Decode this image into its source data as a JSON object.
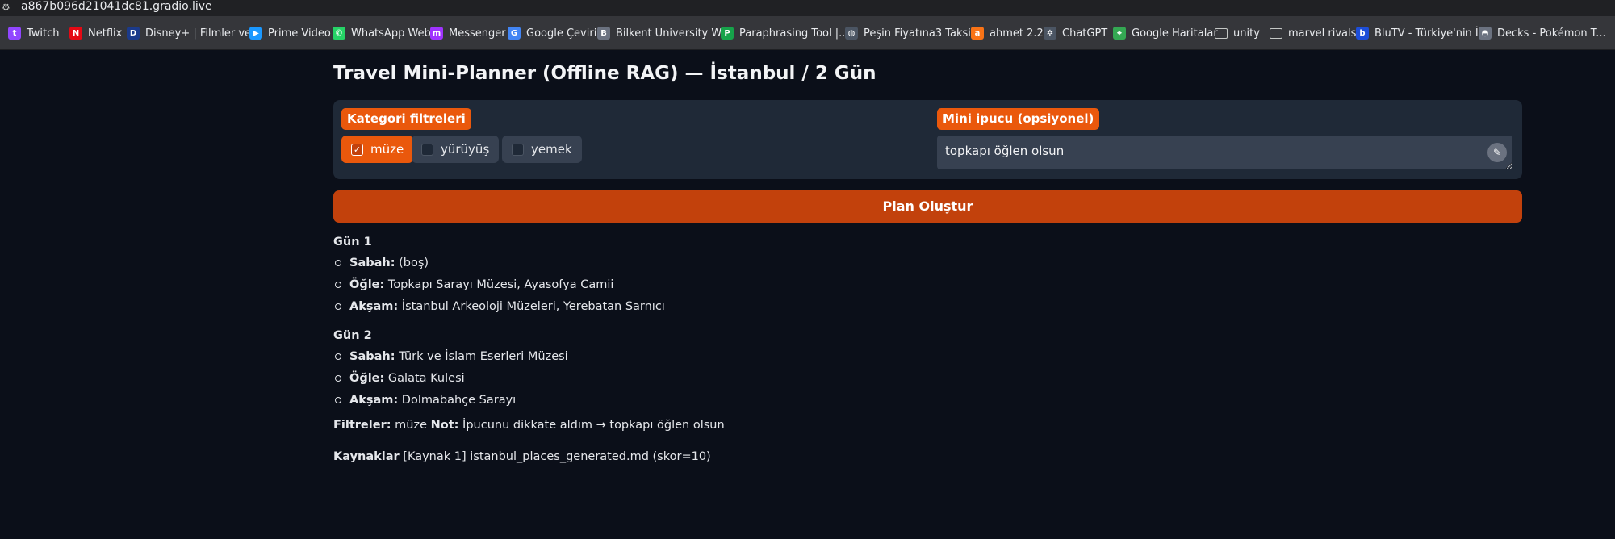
{
  "browser": {
    "url": "a867b096d21041dc81.gradio.live",
    "bookmarks": [
      {
        "label": "Twitch",
        "icon": "twitch-icon",
        "color": "#9146ff",
        "glyph": "t"
      },
      {
        "label": "Netflix",
        "icon": "netflix-icon",
        "color": "#e50914",
        "glyph": "N"
      },
      {
        "label": "Disney+ | Filmler ve...",
        "icon": "disney-icon",
        "color": "#1b3a8a",
        "glyph": "D"
      },
      {
        "label": "Prime Video",
        "icon": "prime-video-icon",
        "color": "#1a98ff",
        "glyph": "▶"
      },
      {
        "label": "WhatsApp Web",
        "icon": "whatsapp-icon",
        "color": "#25d366",
        "glyph": "✆"
      },
      {
        "label": "Messenger",
        "icon": "messenger-icon",
        "color": "#a033ff",
        "glyph": "m"
      },
      {
        "label": "Google Çeviri",
        "icon": "google-translate-icon",
        "color": "#4285f4",
        "glyph": "G"
      },
      {
        "label": "Bilkent University W...",
        "icon": "bilkent-icon",
        "color": "#6b7280",
        "glyph": "B"
      },
      {
        "label": "Paraphrasing Tool |...",
        "icon": "paraphrasing-icon",
        "color": "#16a34a",
        "glyph": "P"
      },
      {
        "label": "Peşin Fiyatına3 Taksi...",
        "icon": "globe-icon",
        "color": "#4b5563",
        "glyph": "◍"
      },
      {
        "label": "ahmet 2.2",
        "icon": "ahmet-icon",
        "color": "#f97316",
        "glyph": "a"
      },
      {
        "label": "ChatGPT",
        "icon": "chatgpt-icon",
        "color": "#4b5563",
        "glyph": "✲"
      },
      {
        "label": "Google Haritalar",
        "icon": "google-maps-icon",
        "color": "#34a853",
        "glyph": "⌖"
      },
      {
        "label": "unity",
        "icon": "folder-icon",
        "color": "",
        "glyph": ""
      },
      {
        "label": "marvel rivals",
        "icon": "folder-icon",
        "color": "",
        "glyph": ""
      },
      {
        "label": "BluTV - Türkiye'nin İ...",
        "icon": "blutv-icon",
        "color": "#1d4ed8",
        "glyph": "b"
      },
      {
        "label": "Decks - Pokémon T...",
        "icon": "pokemon-icon",
        "color": "#6b7280",
        "glyph": "◓"
      }
    ]
  },
  "app": {
    "title": "Travel Mini-Planner (Offline RAG) — İstanbul / 2 Gün",
    "filters_label": "Kategori filtreleri",
    "filters": [
      {
        "label": "müze",
        "checked": true
      },
      {
        "label": "yürüyüş",
        "checked": false
      },
      {
        "label": "yemek",
        "checked": false
      }
    ],
    "hint_label": "Mini ipucu (opsiyonel)",
    "hint_value": "topkapı öğlen olsun",
    "button_label": "Plan Oluştur"
  },
  "output": {
    "days": [
      {
        "title": "Gün 1",
        "items": [
          {
            "key": "Sabah:",
            "value": " (boş)"
          },
          {
            "key": "Öğle:",
            "value": " Topkapı Sarayı Müzesi, Ayasofya Camii"
          },
          {
            "key": "Akşam:",
            "value": " İstanbul Arkeoloji Müzeleri, Yerebatan Sarnıcı"
          }
        ]
      },
      {
        "title": "Gün 2",
        "items": [
          {
            "key": "Sabah:",
            "value": " Türk ve İslam Eserleri Müzesi"
          },
          {
            "key": "Öğle:",
            "value": " Galata Kulesi"
          },
          {
            "key": "Akşam:",
            "value": " Dolmabahçe Sarayı"
          }
        ]
      }
    ],
    "filters_key": "Filtreler:",
    "filters_value": " müze ",
    "note_key": "Not:",
    "note_value": " İpucunu dikkate aldım → topkapı öğlen olsun",
    "sources_key": "Kaynaklar",
    "sources_value": " [Kaynak 1] istanbul_places_generated.md (skor=10)"
  }
}
